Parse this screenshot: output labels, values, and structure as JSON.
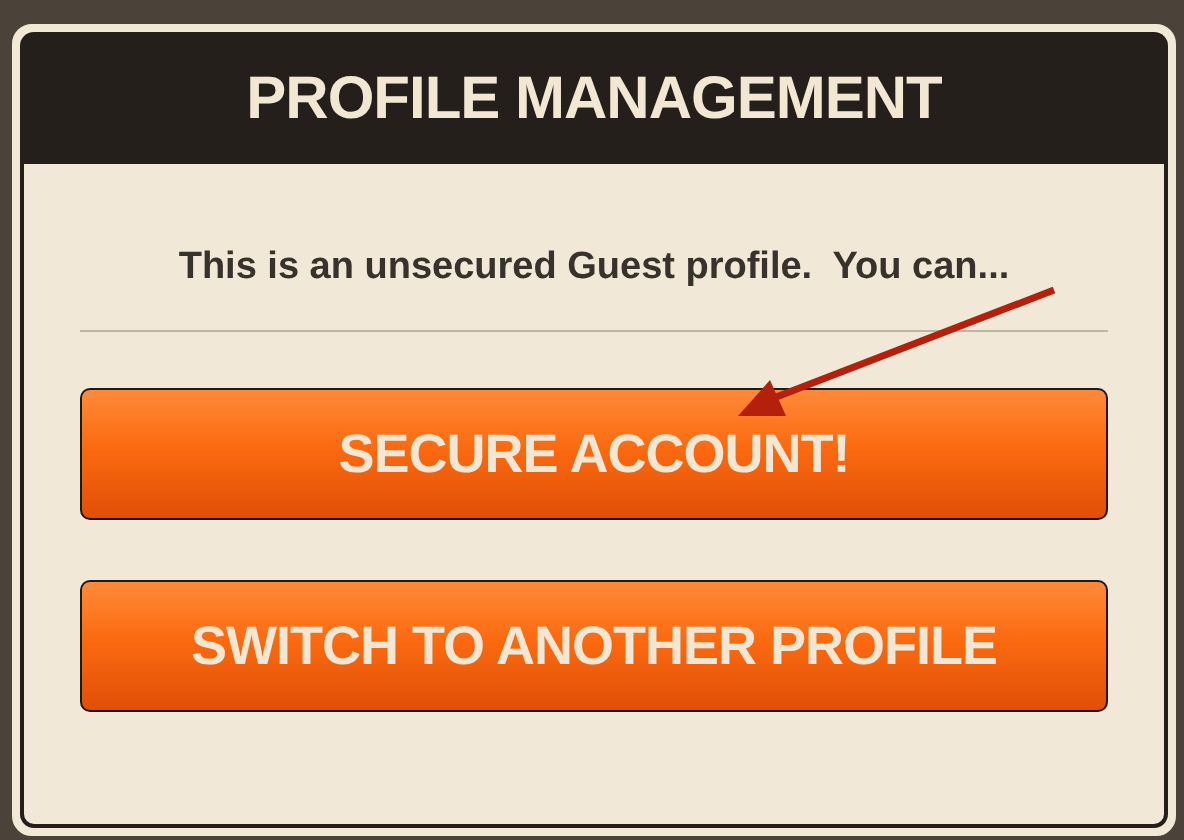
{
  "dialog": {
    "title": "PROFILE MANAGEMENT",
    "message": "This is an unsecured Guest profile.  You can...",
    "buttons": [
      {
        "label": "SECURE ACCOUNT!"
      },
      {
        "label": "SWITCH TO ANOTHER PROFILE"
      }
    ]
  }
}
